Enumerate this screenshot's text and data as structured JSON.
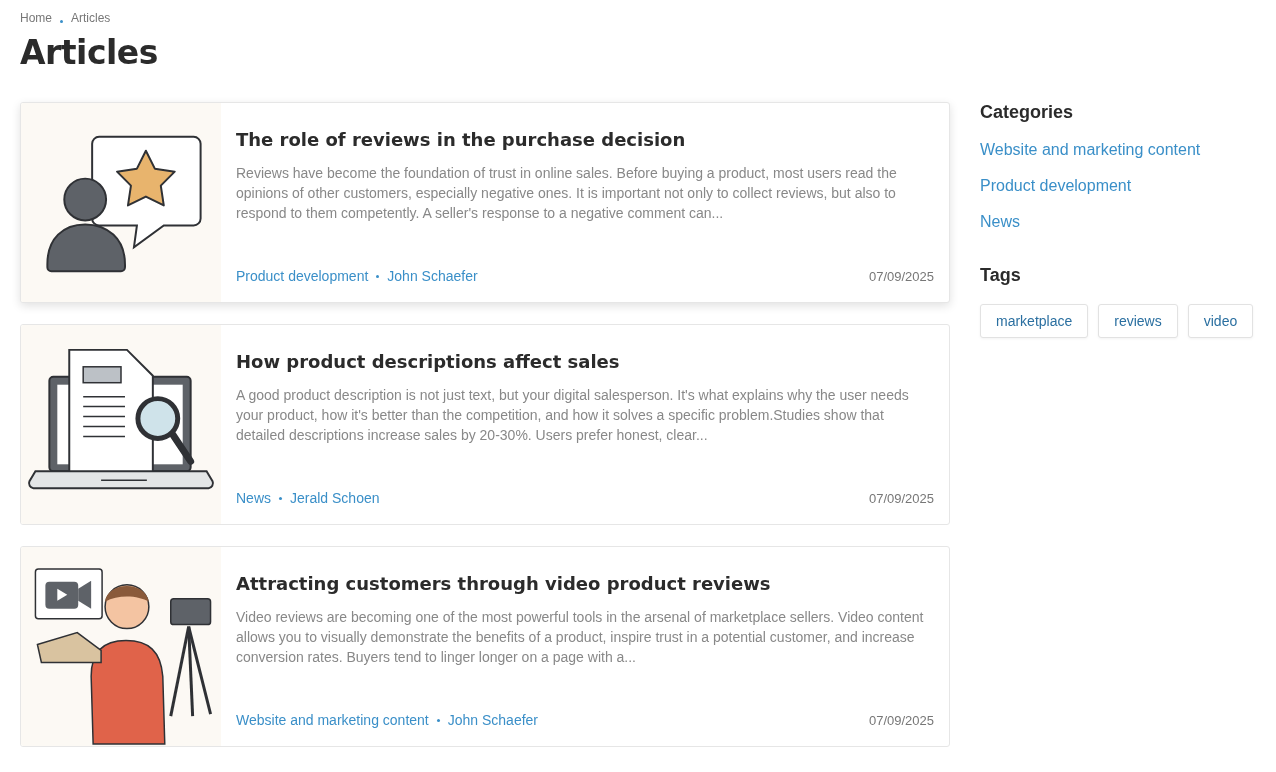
{
  "breadcrumbs": [
    {
      "label": "Home"
    },
    {
      "label": "Articles"
    }
  ],
  "title": "Articles",
  "articles": [
    {
      "kind": "review",
      "hovered": true,
      "title": "The role of reviews in the purchase decision",
      "excerpt": "Reviews have become the foundation of trust in online sales. Before buying a product, most users read the opinions of other customers, especially negative ones. It is important not only to collect reviews, but also to respond to them competently. A seller's response to a negative comment can...",
      "category": "Product development",
      "author": "John Schaefer",
      "date": "07/09/2025"
    },
    {
      "kind": "description",
      "hovered": false,
      "title": "How product descriptions affect sales",
      "excerpt": "A good product description is not just text, but your digital salesperson. It's what explains why the user needs your product, how it's better than the competition, and how it solves a specific problem.Studies show that detailed descriptions increase sales by 20-30%. Users prefer honest, clear...",
      "category": "News",
      "author": "Jerald Schoen",
      "date": "07/09/2025"
    },
    {
      "kind": "video",
      "hovered": false,
      "title": "Attracting customers through video product reviews",
      "excerpt": "Video reviews are becoming one of the most powerful tools in the arsenal of marketplace sellers. Video content allows you to visually demonstrate the benefits of a product, inspire trust in a potential customer, and increase conversion rates. Buyers tend to linger longer on a page with a...",
      "category": "Website and marketing content",
      "author": "John Schaefer",
      "date": "07/09/2025"
    }
  ],
  "sidebar": {
    "categories_title": "Categories",
    "categories": [
      {
        "label": "Website and marketing content"
      },
      {
        "label": "Product development"
      },
      {
        "label": "News"
      }
    ],
    "tags_title": "Tags",
    "tags": [
      {
        "label": "marketplace"
      },
      {
        "label": "reviews"
      },
      {
        "label": "video"
      }
    ]
  }
}
